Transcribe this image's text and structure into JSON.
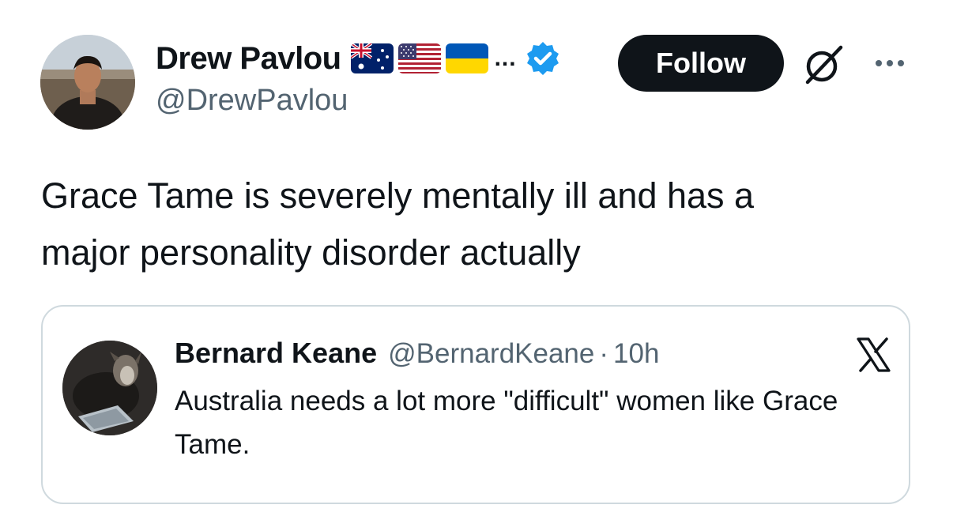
{
  "author": {
    "display_name": "Drew Pavlou",
    "name_overflow": "...",
    "handle": "@DrewPavlou",
    "flags": [
      "australia-flag-icon",
      "usa-flag-icon",
      "ukraine-flag-icon"
    ],
    "verified_icon": "verified-badge-icon"
  },
  "actions": {
    "follow_label": "Follow",
    "grok_icon": "grok-icon",
    "more_icon": "more-options-icon"
  },
  "tweet": {
    "text": "Grace Tame is severely mentally ill and has a\nmajor personality disorder actually"
  },
  "quote": {
    "display_name": "Bernard Keane",
    "handle": "@BernardKeane",
    "separator": "·",
    "time": "10h",
    "text": "Australia needs a lot more \"difficult\" women like Grace Tame.",
    "platform_icon": "x-logo-icon"
  },
  "colors": {
    "text_primary": "#0f1419",
    "text_secondary": "#536471",
    "verified_blue": "#1d9bf0",
    "card_border": "#cfd9de",
    "follow_bg": "#0f1419"
  }
}
